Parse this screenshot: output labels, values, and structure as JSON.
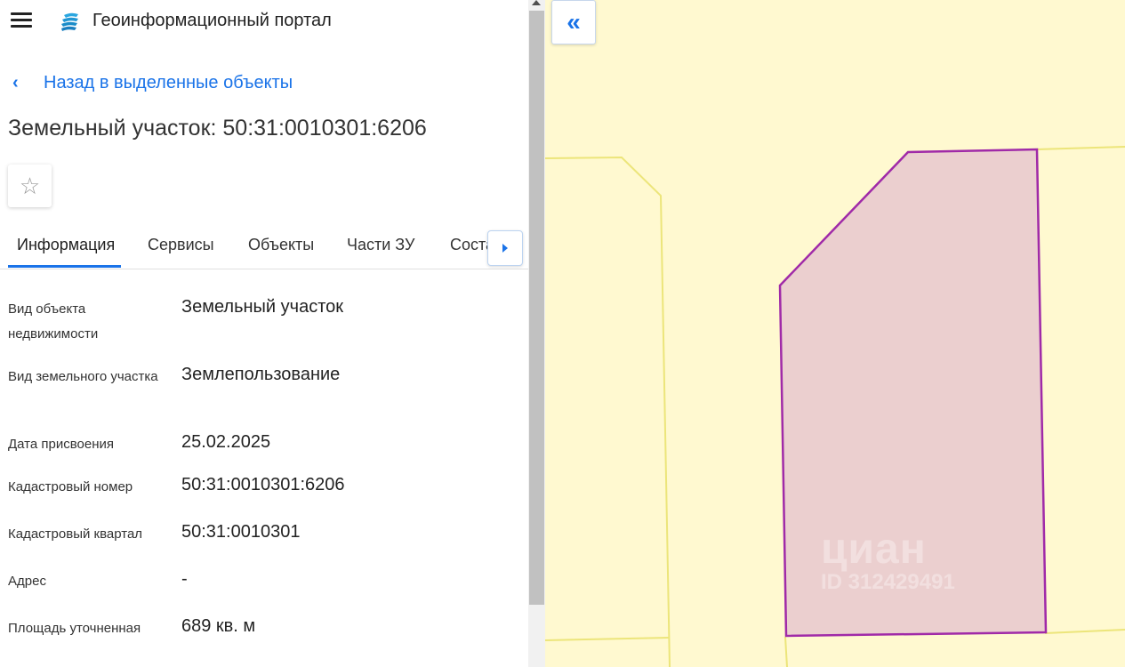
{
  "app": {
    "title": "Геоинформационный портал"
  },
  "nav": {
    "back_label": "Назад в выделенные объекты"
  },
  "object": {
    "title": "Земельный участок: 50:31:0010301:6206"
  },
  "tabs": [
    {
      "label": "Информация",
      "active": true
    },
    {
      "label": "Сервисы"
    },
    {
      "label": "Объекты"
    },
    {
      "label": "Части ЗУ"
    },
    {
      "label": "Соста..."
    }
  ],
  "properties": [
    {
      "label": "Вид объекта недвижимости",
      "value": "Земельный участок"
    },
    {
      "label": "Вид земельного участка",
      "value": "Землепользование"
    },
    {
      "label": "Дата присвоения",
      "value": "25.02.2025"
    },
    {
      "label": "Кадастровый номер",
      "value": "50:31:0010301:6206"
    },
    {
      "label": "Кадастровый квартал",
      "value": "50:31:0010301"
    },
    {
      "label": "Адрес",
      "value": "-"
    },
    {
      "label": "Площадь уточненная",
      "value": "689 кв. м"
    }
  ],
  "map": {
    "watermark_brand": "циан",
    "watermark_id": "ID 312429491",
    "colors": {
      "background": "#fff9d0",
      "parcel_fill": "#ebcfcf",
      "parcel_stroke": "#a02aa8",
      "boundary": "#ece57a"
    }
  },
  "icons": {
    "menu": "hamburger-icon",
    "logo": "portal-logo-icon",
    "back": "chevron-left-icon",
    "favorite": "star-outline-icon",
    "tabs_next": "triangle-right-icon",
    "collapse": "double-chevron-left-icon"
  }
}
